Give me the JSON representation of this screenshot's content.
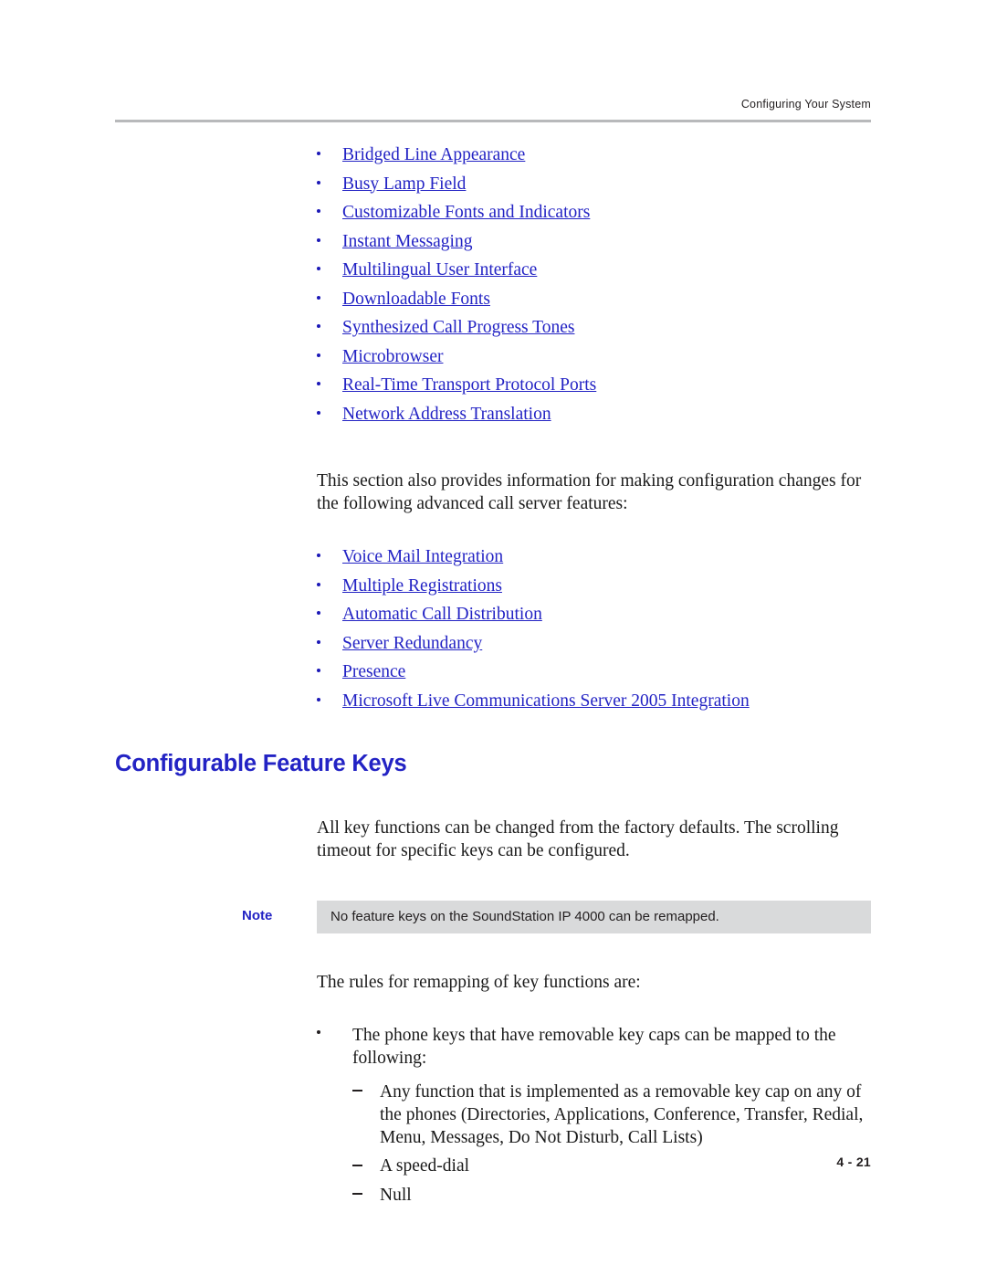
{
  "header": {
    "running_head": "Configuring Your System"
  },
  "footer": {
    "page_number": "4 - 21"
  },
  "feature_links": [
    "Bridged Line Appearance",
    "Busy Lamp Field",
    "Customizable Fonts and Indicators",
    "Instant Messaging",
    "Multilingual User Interface",
    "Downloadable Fonts",
    "Synthesized Call Progress Tones",
    "Microbrowser",
    "Real-Time Transport Protocol Ports",
    "Network Address Translation"
  ],
  "intro_paragraph": "This section also provides information for making configuration changes for the following advanced call server features:",
  "advanced_links": [
    "Voice Mail Integration",
    "Multiple Registrations",
    "Automatic Call Distribution",
    "Server Redundancy",
    "Presence",
    "Microsoft Live Communications Server 2005 Integration"
  ],
  "section": {
    "heading": "Configurable Feature Keys",
    "body_paragraph": "All key functions can be changed from the factory defaults. The scrolling timeout for specific keys can be configured.",
    "note": {
      "label": "Note",
      "text": "No feature keys on the SoundStation IP 4000 can be remapped."
    },
    "rules_intro": "The rules for remapping of key functions are:",
    "rules": [
      "The phone keys that have removable key caps can be mapped to the following:"
    ],
    "sub_rules": [
      "Any function that is implemented as a removable key cap on any of the phones (Directories, Applications, Conference, Transfer, Redial, Menu, Messages, Do Not Disturb, Call Lists)",
      "A speed-dial",
      "Null"
    ]
  },
  "colors": {
    "link": "#2323c4",
    "heading": "#2323c4",
    "rule": "#b8b9bb",
    "note_bg": "#d9dadb"
  }
}
